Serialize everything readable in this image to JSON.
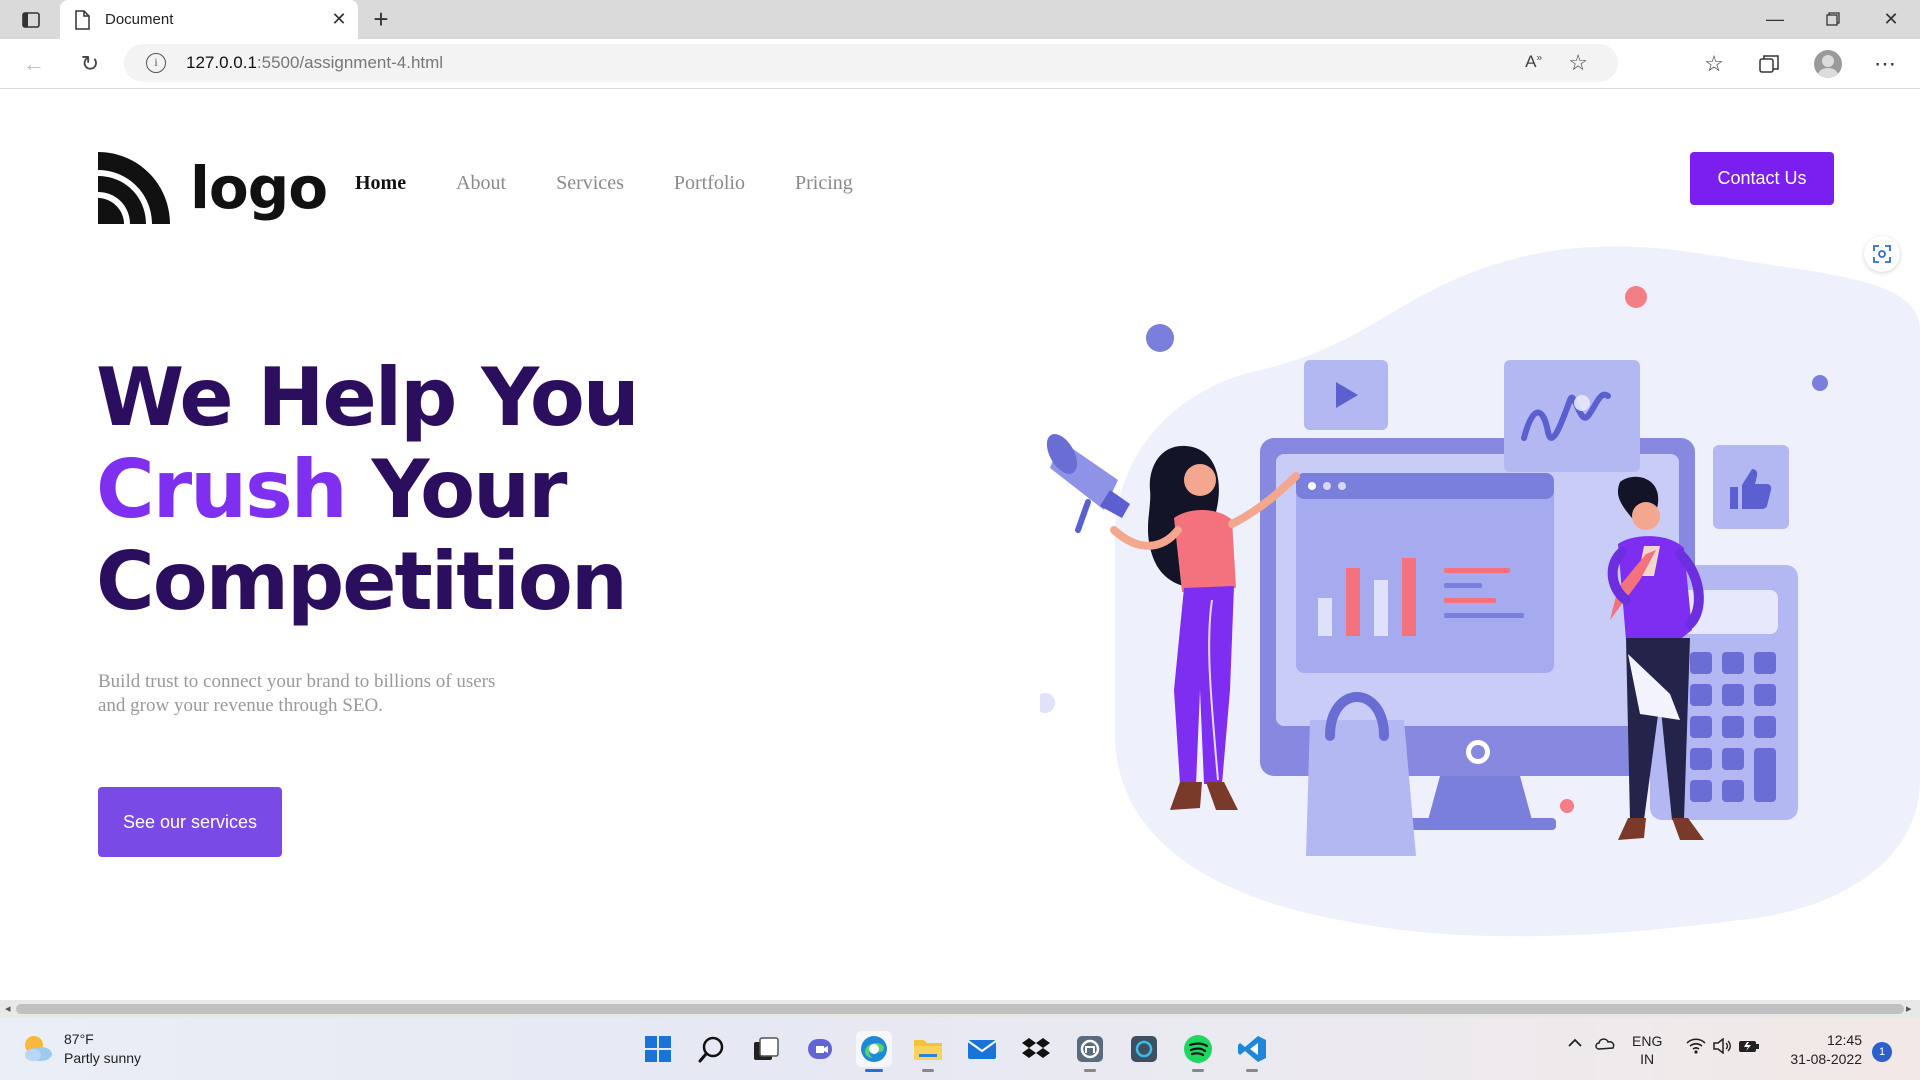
{
  "browser": {
    "tab_title": "Document",
    "url_host": "127.0.0.1",
    "url_path": ":5500/assignment-4.html",
    "new_tab_icon": "plus-icon",
    "window_controls": [
      "minimize-icon",
      "restore-icon",
      "close-icon"
    ]
  },
  "site": {
    "logo_text": "logo",
    "nav": [
      {
        "label": "Home",
        "active": true
      },
      {
        "label": "About",
        "active": false
      },
      {
        "label": "Services",
        "active": false
      },
      {
        "label": "Portfolio",
        "active": false
      },
      {
        "label": "Pricing",
        "active": false
      }
    ],
    "contact_label": "Contact Us",
    "hero": {
      "line1": "We Help You",
      "line2_accent": "Crush",
      "line2_rest": " Your",
      "line3": "Competition",
      "subtitle": "Build trust to connect your brand to billions of users and grow your revenue through SEO.",
      "cta_label": "See our services"
    },
    "colors": {
      "primary": "#7a1ff0",
      "heading": "#2c0e5e",
      "accent": "#7f2ff0",
      "cta": "#7a4ae6"
    }
  },
  "taskbar": {
    "weather_temp": "87°F",
    "weather_desc": "Partly sunny",
    "lang_line1": "ENG",
    "lang_line2": "IN",
    "time": "12:45",
    "date": "31-08-2022",
    "notifications": "1"
  }
}
